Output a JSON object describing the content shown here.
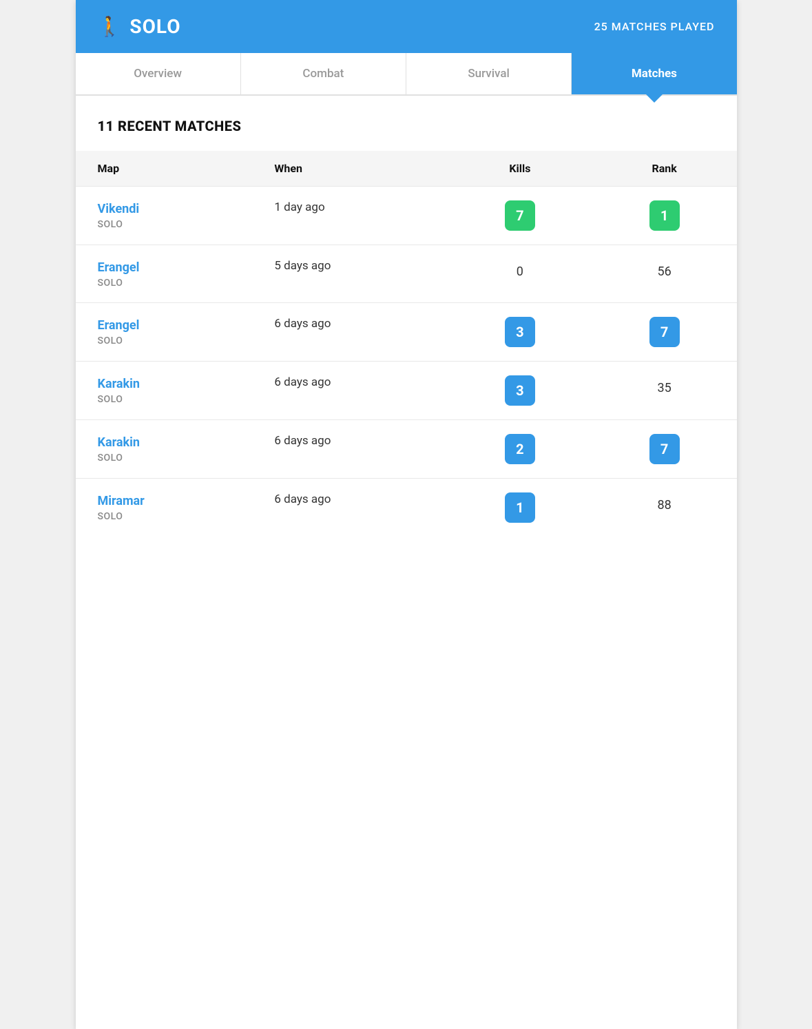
{
  "header": {
    "icon": "🚶",
    "title": "SOLO",
    "matches_count": "25 MATCHES PLAYED"
  },
  "tabs": [
    {
      "id": "overview",
      "label": "Overview",
      "active": false
    },
    {
      "id": "combat",
      "label": "Combat",
      "active": false
    },
    {
      "id": "survival",
      "label": "Survival",
      "active": false
    },
    {
      "id": "matches",
      "label": "Matches",
      "active": true
    }
  ],
  "section_title": "11 RECENT MATCHES",
  "table": {
    "columns": [
      "Map",
      "When",
      "Kills",
      "Rank"
    ],
    "rows": [
      {
        "map": "Vikendi",
        "mode": "SOLO",
        "when": "1 day ago",
        "kills": "7",
        "kills_badge": "green",
        "rank": "1",
        "rank_badge": "green"
      },
      {
        "map": "Erangel",
        "mode": "SOLO",
        "when": "5 days ago",
        "kills": "0",
        "kills_badge": null,
        "rank": "56",
        "rank_badge": null
      },
      {
        "map": "Erangel",
        "mode": "SOLO",
        "when": "6 days ago",
        "kills": "3",
        "kills_badge": "blue",
        "rank": "7",
        "rank_badge": "blue"
      },
      {
        "map": "Karakin",
        "mode": "SOLO",
        "when": "6 days ago",
        "kills": "3",
        "kills_badge": "blue",
        "rank": "35",
        "rank_badge": null
      },
      {
        "map": "Karakin",
        "mode": "SOLO",
        "when": "6 days ago",
        "kills": "2",
        "kills_badge": "blue",
        "rank": "7",
        "rank_badge": "blue"
      },
      {
        "map": "Miramar",
        "mode": "SOLO",
        "when": "6 days ago",
        "kills": "1",
        "kills_badge": "blue",
        "rank": "88",
        "rank_badge": null,
        "partial": true
      }
    ]
  },
  "colors": {
    "primary": "#3399e6",
    "green": "#2ecc71",
    "blue": "#3399e6"
  }
}
